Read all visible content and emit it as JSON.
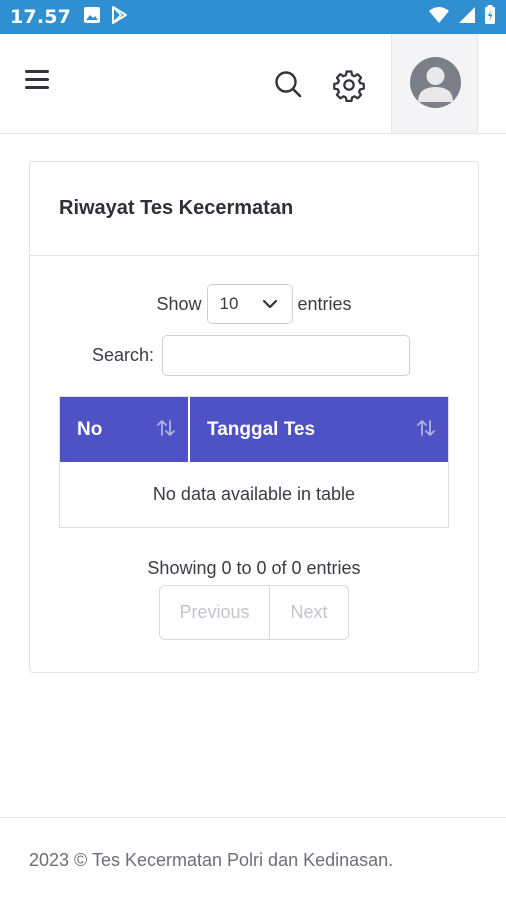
{
  "status_bar": {
    "time": "17.57",
    "left_icons": [
      "image-icon",
      "play-store-icon"
    ],
    "right_icons": [
      "wifi-icon",
      "signal-icon",
      "battery-icon"
    ],
    "color": "#2f8fd0"
  },
  "topbar": {
    "icons": [
      "menu-icon",
      "search-icon",
      "gear-icon",
      "user-avatar-icon"
    ]
  },
  "card": {
    "title": "Riwayat Tes Kecermatan",
    "length": {
      "prefix": "Show",
      "selected": "10",
      "suffix": "entries"
    },
    "search": {
      "label": "Search:",
      "value": ""
    },
    "table": {
      "columns": [
        "No",
        "Tanggal Tes"
      ],
      "header_color": "#4f52c4",
      "empty_message": "No data available in table"
    },
    "info": "Showing 0 to 0 of 0 entries",
    "pagination": {
      "previous": "Previous",
      "next": "Next"
    }
  },
  "footer": {
    "text": "2023 © Tes Kecermatan Polri dan Kedinasan."
  }
}
